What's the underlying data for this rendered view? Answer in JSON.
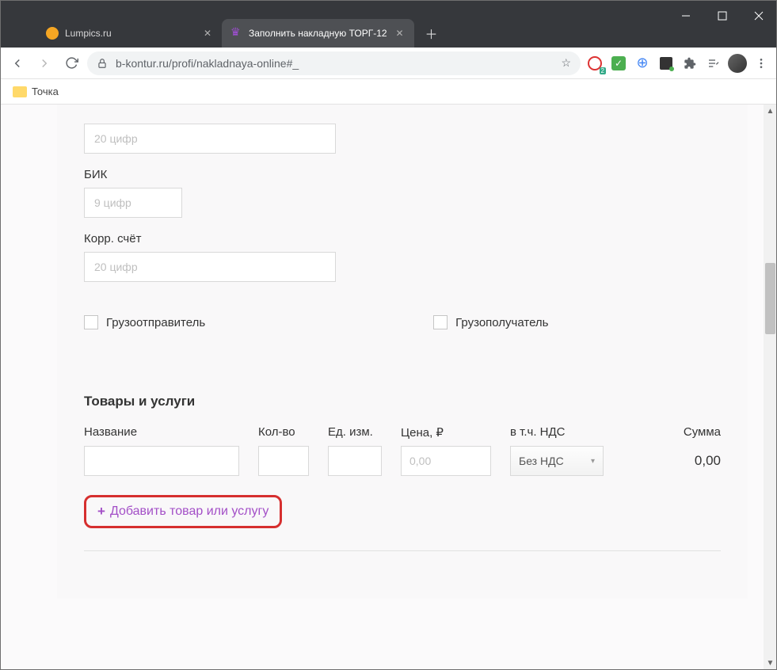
{
  "window": {
    "tabs": [
      {
        "label": "Lumpics.ru",
        "active": false
      },
      {
        "label": "Заполнить накладную ТОРГ-12",
        "active": true
      }
    ]
  },
  "addressbar": {
    "url_display": "b-kontur.ru/profi/nakladnaya-online#_"
  },
  "bookmarks": {
    "item1": "Точка"
  },
  "form": {
    "acct_placeholder": "20 цифр",
    "bik_label": "БИК",
    "bik_placeholder": "9 цифр",
    "corr_label": "Корр. счёт",
    "corr_placeholder": "20 цифр",
    "shipper_label": "Грузоотправитель",
    "consignee_label": "Грузополучатель"
  },
  "goods": {
    "section_title": "Товары и услуги",
    "headers": {
      "name": "Название",
      "qty": "Кол-во",
      "unit": "Ед. изм.",
      "price": "Цена, ₽",
      "vat": "в т.ч. НДС",
      "sum": "Сумма"
    },
    "row": {
      "price_placeholder": "0,00",
      "vat_value": "Без НДС",
      "sum_value": "0,00"
    },
    "add_button": "Добавить товар или услугу"
  }
}
